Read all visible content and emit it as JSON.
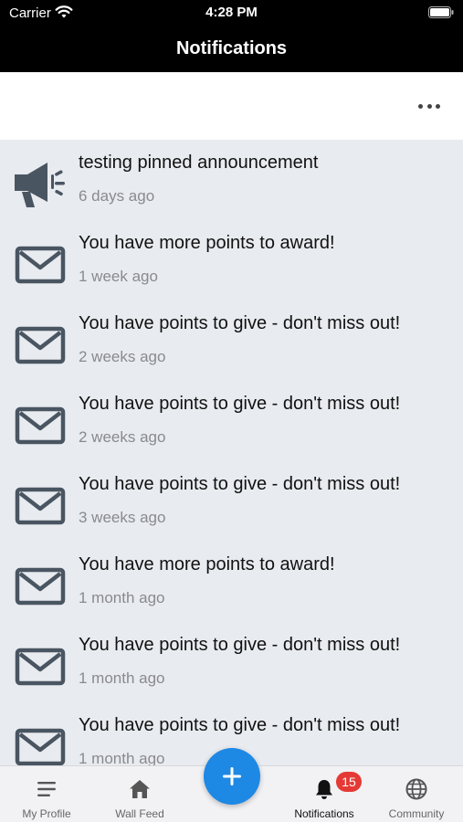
{
  "status_bar": {
    "carrier": "Carrier",
    "time": "4:28 PM"
  },
  "header": {
    "title": "Notifications"
  },
  "notifications": [
    {
      "icon": "megaphone-icon",
      "title": "testing pinned announcement",
      "time": "6 days ago"
    },
    {
      "icon": "envelope-icon",
      "title": "You have more points to award!",
      "time": "1 week ago"
    },
    {
      "icon": "envelope-icon",
      "title": "You have points to give - don't miss out!",
      "time": "2 weeks ago"
    },
    {
      "icon": "envelope-icon",
      "title": "You have points to give - don't miss out!",
      "time": "2 weeks ago"
    },
    {
      "icon": "envelope-icon",
      "title": "You have points to give - don't miss out!",
      "time": "3 weeks ago"
    },
    {
      "icon": "envelope-icon",
      "title": "You have more points to award!",
      "time": "1 month ago"
    },
    {
      "icon": "envelope-icon",
      "title": "You have points to give - don't miss out!",
      "time": "1 month ago"
    },
    {
      "icon": "envelope-icon",
      "title": "You have points to give - don't miss out!",
      "time": "1 month ago"
    }
  ],
  "tab_bar": {
    "tabs": [
      {
        "label": "My Profile",
        "icon": "menu-icon"
      },
      {
        "label": "Wall Feed",
        "icon": "home-icon"
      },
      {
        "label": "Notifications",
        "icon": "bell-icon",
        "badge": "15",
        "active": true
      },
      {
        "label": "Community",
        "icon": "globe-icon"
      }
    ],
    "fab_icon": "plus-icon"
  },
  "colors": {
    "accent": "#1e88e5",
    "badge": "#e53935",
    "icon": "#4a5562",
    "header": "#000000"
  }
}
